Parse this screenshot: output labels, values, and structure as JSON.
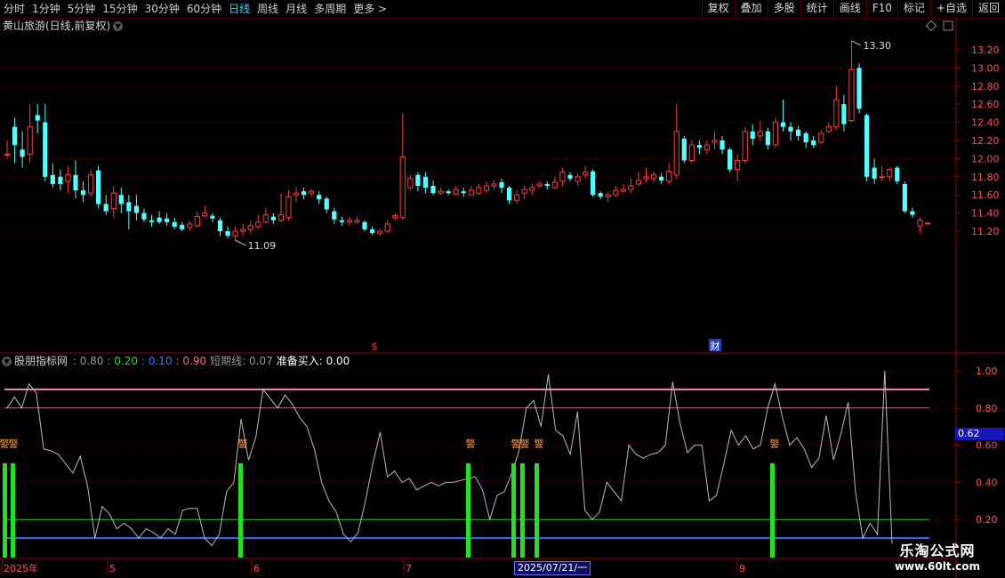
{
  "toolbar": {
    "periods": [
      "分时",
      "1分钟",
      "5分钟",
      "15分钟",
      "30分钟",
      "60分钟",
      "日线",
      "周线",
      "月线",
      "多周期",
      "更多 >"
    ],
    "active_period": "日线",
    "buttons": [
      "复权",
      "叠加",
      "多股",
      "统计",
      "画线",
      "F10",
      "标记",
      "+自选",
      "返回"
    ]
  },
  "price_panel": {
    "title": "黄山旅游(日线,前复权)",
    "high_label": "13.30",
    "low_label": "11.09",
    "markers": [
      "$",
      "财"
    ],
    "y_ticks": [
      "13.20",
      "13.00",
      "12.80",
      "12.60",
      "12.40",
      "12.20",
      "12.00",
      "11.80",
      "11.60",
      "11.40",
      "11.20"
    ]
  },
  "indicator_panel": {
    "name": "股朋指标网",
    "legend": [
      {
        "text": ": 0.80",
        "color": "#9a9a9a"
      },
      {
        "text": ": 0.20",
        "color": "#22e022"
      },
      {
        "text": ": 0.10",
        "color": "#3a7aff"
      },
      {
        "text": ": 0.90",
        "color": "#ff6a7a"
      },
      {
        "text": "短期线: 0.07",
        "color": "#9a9a9a"
      },
      {
        "text": "准备买入: 0.00",
        "color": "#ffffff"
      }
    ],
    "y_ticks": [
      "1.00",
      "0.80",
      "0.60",
      "0.40",
      "0.20"
    ],
    "current_value": "0.62",
    "alert_label": "警"
  },
  "x_axis": {
    "labels": [
      "2025年",
      "5",
      "6",
      "7",
      "9"
    ],
    "cursor_date": "2025/07/21/一"
  },
  "watermark": {
    "name": "乐淘公式网",
    "site": "www.60lt.com"
  },
  "colors": {
    "up": "#ff3b3b",
    "down": "#54ffff",
    "grid": "#5a0000",
    "buy_bar": "#22e022"
  }
}
